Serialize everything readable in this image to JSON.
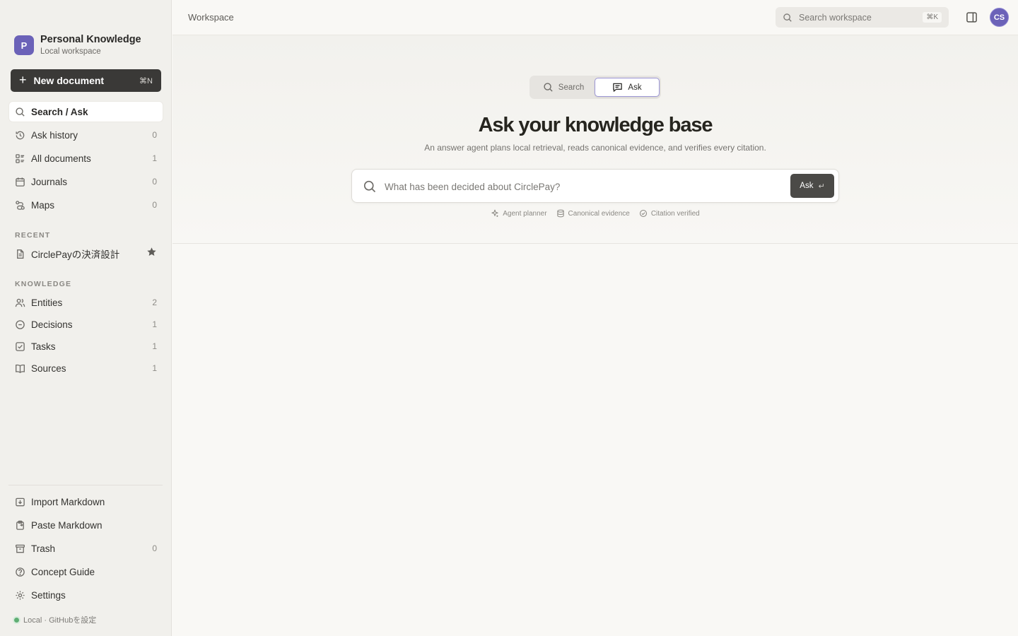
{
  "workspace": {
    "avatar_letter": "P",
    "title": "Personal Knowledge",
    "subtitle": "Local workspace"
  },
  "new_document": {
    "label": "New document",
    "shortcut": "⌘N"
  },
  "nav": [
    {
      "label": "Search / Ask",
      "count": "",
      "icon": "search-icon",
      "active": true
    },
    {
      "label": "Ask history",
      "count": "0",
      "icon": "history-icon"
    },
    {
      "label": "All documents",
      "count": "1",
      "icon": "documents-icon"
    },
    {
      "label": "Journals",
      "count": "0",
      "icon": "calendar-icon"
    },
    {
      "label": "Maps",
      "count": "0",
      "icon": "map-icon"
    }
  ],
  "recent": {
    "heading": "RECENT",
    "items": [
      {
        "label": "CirclePayの決済設計",
        "icon": "document-icon",
        "starred": true
      }
    ]
  },
  "knowledge": {
    "heading": "KNOWLEDGE",
    "items": [
      {
        "label": "Entities",
        "count": "2",
        "icon": "users-icon"
      },
      {
        "label": "Decisions",
        "count": "1",
        "icon": "decision-icon"
      },
      {
        "label": "Tasks",
        "count": "1",
        "icon": "task-icon"
      },
      {
        "label": "Sources",
        "count": "1",
        "icon": "book-icon"
      }
    ]
  },
  "footer_nav": [
    {
      "label": "Import Markdown",
      "count": "",
      "icon": "import-icon"
    },
    {
      "label": "Paste Markdown",
      "count": "",
      "icon": "paste-icon"
    },
    {
      "label": "Trash",
      "count": "0",
      "icon": "trash-icon"
    },
    {
      "label": "Concept Guide",
      "count": "",
      "icon": "help-icon"
    },
    {
      "label": "Settings",
      "count": "",
      "icon": "gear-icon"
    }
  ],
  "status": {
    "text": "Local · GitHubを設定",
    "color": "#5fae73"
  },
  "topbar": {
    "breadcrumb": "Workspace",
    "search_placeholder": "Search workspace",
    "search_shortcut": "⌘K",
    "user_initials": "CS"
  },
  "hero": {
    "modes": {
      "search": "Search",
      "ask": "Ask",
      "active": "Ask"
    },
    "title": "Ask your knowledge base",
    "subtitle": "An answer agent plans local retrieval, reads canonical evidence, and verifies every citation.",
    "input_placeholder": "What has been decided about CirclePay?",
    "input_value": "",
    "ask_button": "Ask",
    "ask_enter_glyph": "↵",
    "chips": [
      "Agent planner",
      "Canonical evidence",
      "Citation verified"
    ]
  },
  "colors": {
    "accent": "#6b62b8",
    "ask_button": "#4b4a47",
    "new_doc_button": "#3a3937"
  }
}
